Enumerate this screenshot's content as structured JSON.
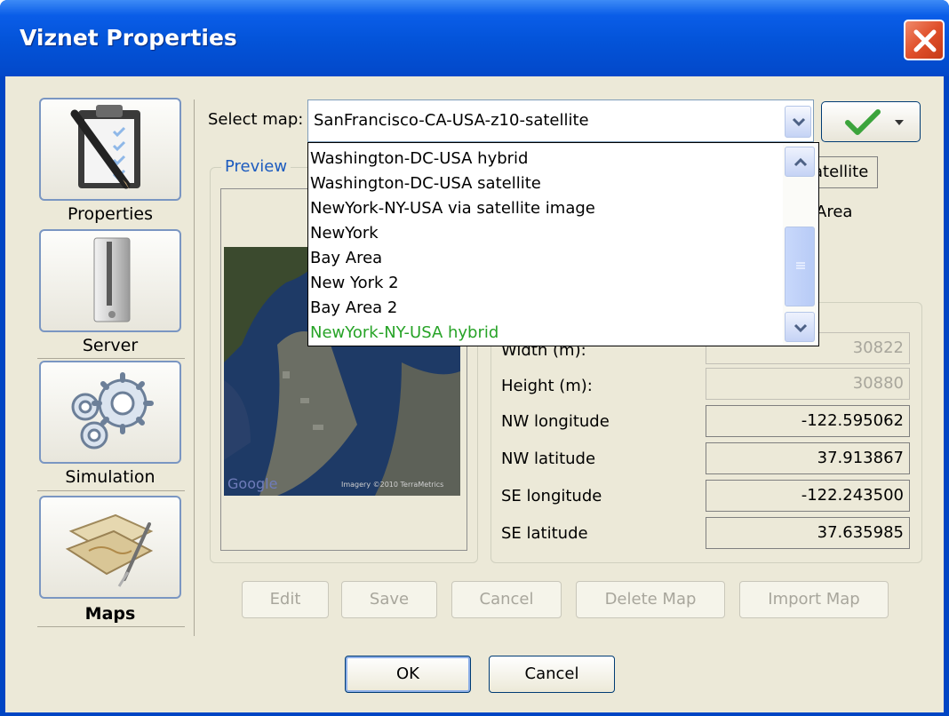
{
  "window": {
    "title": "Viznet Properties"
  },
  "nav": {
    "items": [
      {
        "label": "Properties",
        "icon": "clipboard-pen-icon",
        "selected": false
      },
      {
        "label": "Server",
        "icon": "server-tower-icon",
        "selected": false
      },
      {
        "label": "Simulation",
        "icon": "gears-icon",
        "selected": false
      },
      {
        "label": "Maps",
        "icon": "maps-icon",
        "selected": true
      }
    ]
  },
  "select_map": {
    "label": "Select map:",
    "value": "SanFrancisco-CA-USA-z10-satellite",
    "options": [
      "Washington-DC-USA hybrid",
      "Washington-DC-USA satellite",
      "NewYork-NY-USA via satellite image",
      "NewYork",
      "Bay Area",
      "New York 2",
      "Bay Area 2",
      "NewYork-NY-USA hybrid"
    ],
    "highlighted_option": "NewYork-NY-USA hybrid"
  },
  "preview": {
    "title": "Preview",
    "watermark_left": "Google",
    "watermark_right": "Imagery ©2010 TerraMetrics"
  },
  "partial": {
    "tab_text": "atellite",
    "area_text": "Area"
  },
  "fields": [
    {
      "label": "Width (m):",
      "value": "30822",
      "disabled": true
    },
    {
      "label": "Height (m):",
      "value": "30880",
      "disabled": true
    },
    {
      "label": "NW longitude",
      "value": "-122.595062",
      "disabled": false
    },
    {
      "label": "NW latitude",
      "value": "37.913867",
      "disabled": false
    },
    {
      "label": "SE longitude",
      "value": "-122.243500",
      "disabled": false
    },
    {
      "label": "SE latitude",
      "value": "37.635985",
      "disabled": false
    }
  ],
  "actions": {
    "edit": "Edit",
    "save": "Save",
    "cancel": "Cancel",
    "delete": "Delete Map",
    "import": "Import Map"
  },
  "dialog": {
    "ok": "OK",
    "cancel": "Cancel"
  },
  "colors": {
    "titlebar": "#0353d8",
    "client": "#ece9d8",
    "highlight_option": "#27a327",
    "group_title": "#1c5bbf"
  }
}
